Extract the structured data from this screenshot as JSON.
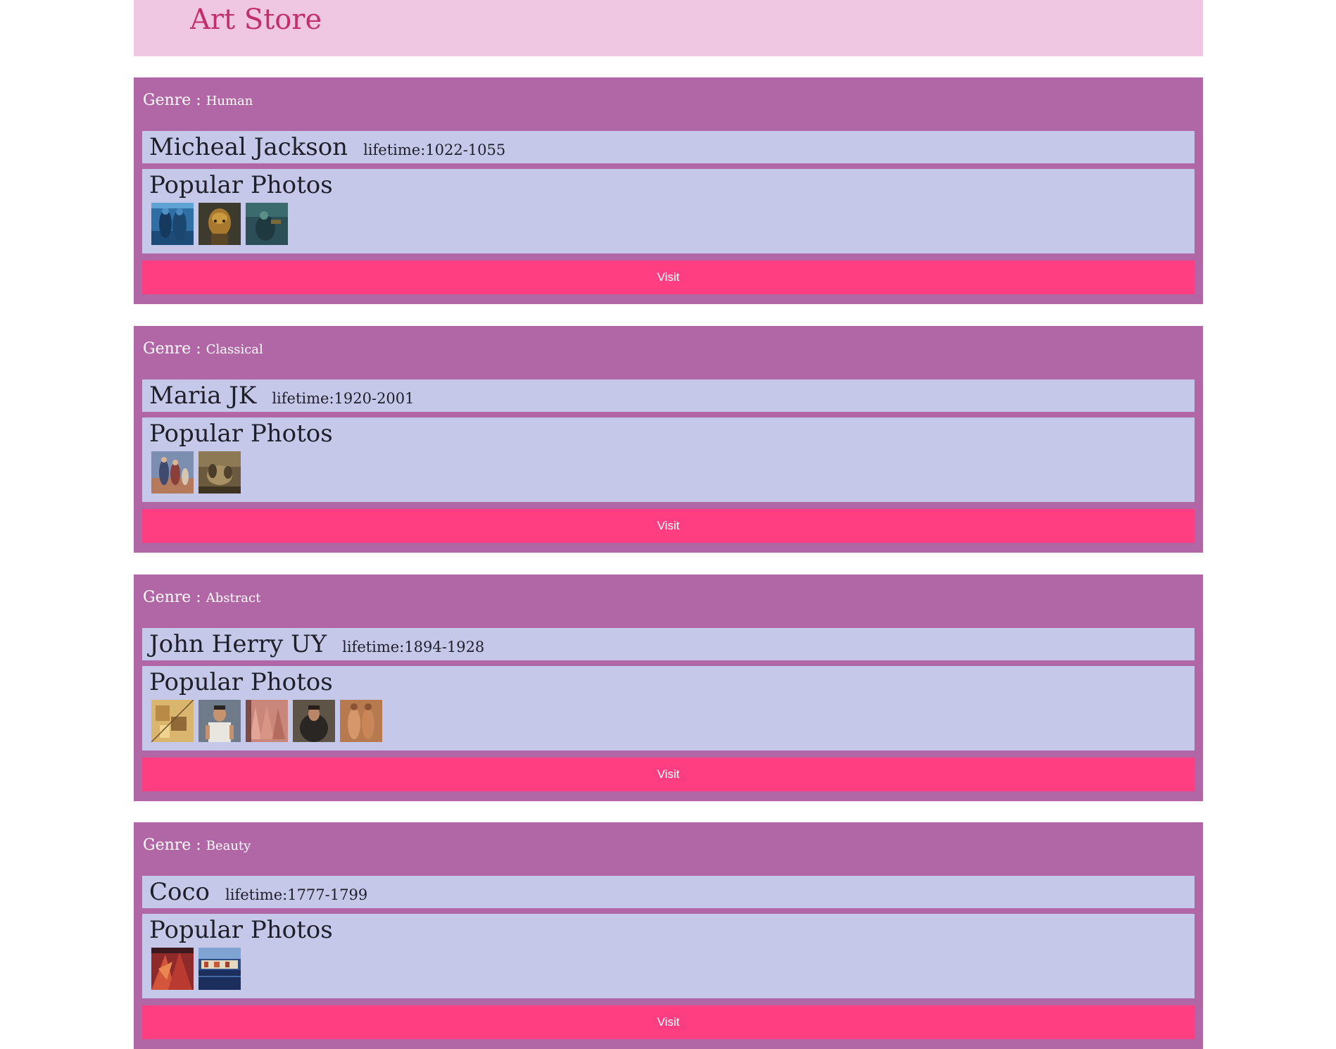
{
  "header": {
    "title": "Art Store",
    "background": "#f0c7e2",
    "title_color": "#c2306b"
  },
  "colors": {
    "card_background": "#b167a6",
    "panel_background": "#c5c8e8",
    "button_background": "#ff3e82"
  },
  "artists": [
    {
      "genre_label": "Genre : ",
      "genre": "Human",
      "name": "Micheal Jackson",
      "lifetime": "lifetime:1022-1055",
      "photos_title": "Popular Photos",
      "visit_label": "Visit",
      "photo_count": 3
    },
    {
      "genre_label": "Genre : ",
      "genre": "Classical",
      "name": "Maria JK",
      "lifetime": "lifetime:1920-2001",
      "photos_title": "Popular Photos",
      "visit_label": "Visit",
      "photo_count": 2
    },
    {
      "genre_label": "Genre : ",
      "genre": "Abstract",
      "name": "John Herry UY",
      "lifetime": "lifetime:1894-1928",
      "photos_title": "Popular Photos",
      "visit_label": "Visit",
      "photo_count": 5
    },
    {
      "genre_label": "Genre : ",
      "genre": "Beauty",
      "name": "Coco",
      "lifetime": "lifetime:1777-1799",
      "photos_title": "Popular Photos",
      "visit_label": "Visit",
      "photo_count": 2
    }
  ]
}
